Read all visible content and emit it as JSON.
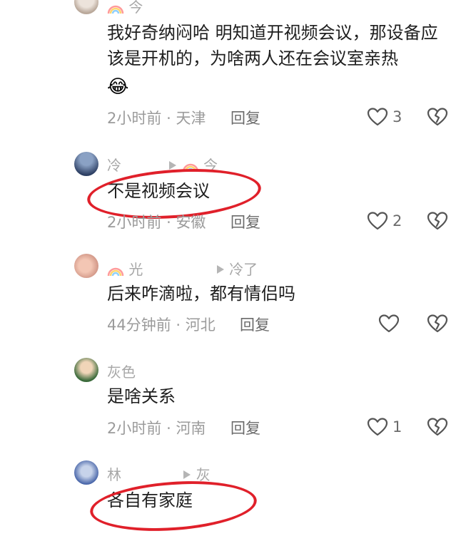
{
  "comments": [
    {
      "name": "今",
      "text": "我好奇纳闷哈 明知道开视频会议，那设备应该是开机的，为啥两人还在会议室亲热",
      "emoji": "😂",
      "time": "2小时前",
      "location": "天津",
      "reply": "回复",
      "likes": "3"
    },
    {
      "name": "冷",
      "reply_to": "今",
      "text": "不是视频会议",
      "time": "2小时前",
      "location": "安徽",
      "reply": "回复",
      "likes": "2"
    },
    {
      "name": "光",
      "reply_to": "冷了",
      "text": "后来咋滴啦，都有情侣吗",
      "time": "44分钟前",
      "location": "河北",
      "reply": "回复",
      "likes": ""
    },
    {
      "name": "灰色",
      "text": "是啥关系",
      "time": "2小时前",
      "location": "河南",
      "reply": "回复",
      "likes": "1"
    },
    {
      "name": "林",
      "reply_to": "灰",
      "text": "各自有家庭",
      "time": "",
      "location": "",
      "reply": "",
      "likes": ""
    }
  ],
  "separator": "·",
  "icons": {
    "like": "heart-outline-icon",
    "dislike": "broken-heart-icon",
    "reply_arrow": "play-triangle-icon",
    "rainbow": "rainbow-icon"
  },
  "colors": {
    "annotation_circle": "#e0202a",
    "name": "#a7a7a7",
    "meta": "#9b9b9b"
  }
}
